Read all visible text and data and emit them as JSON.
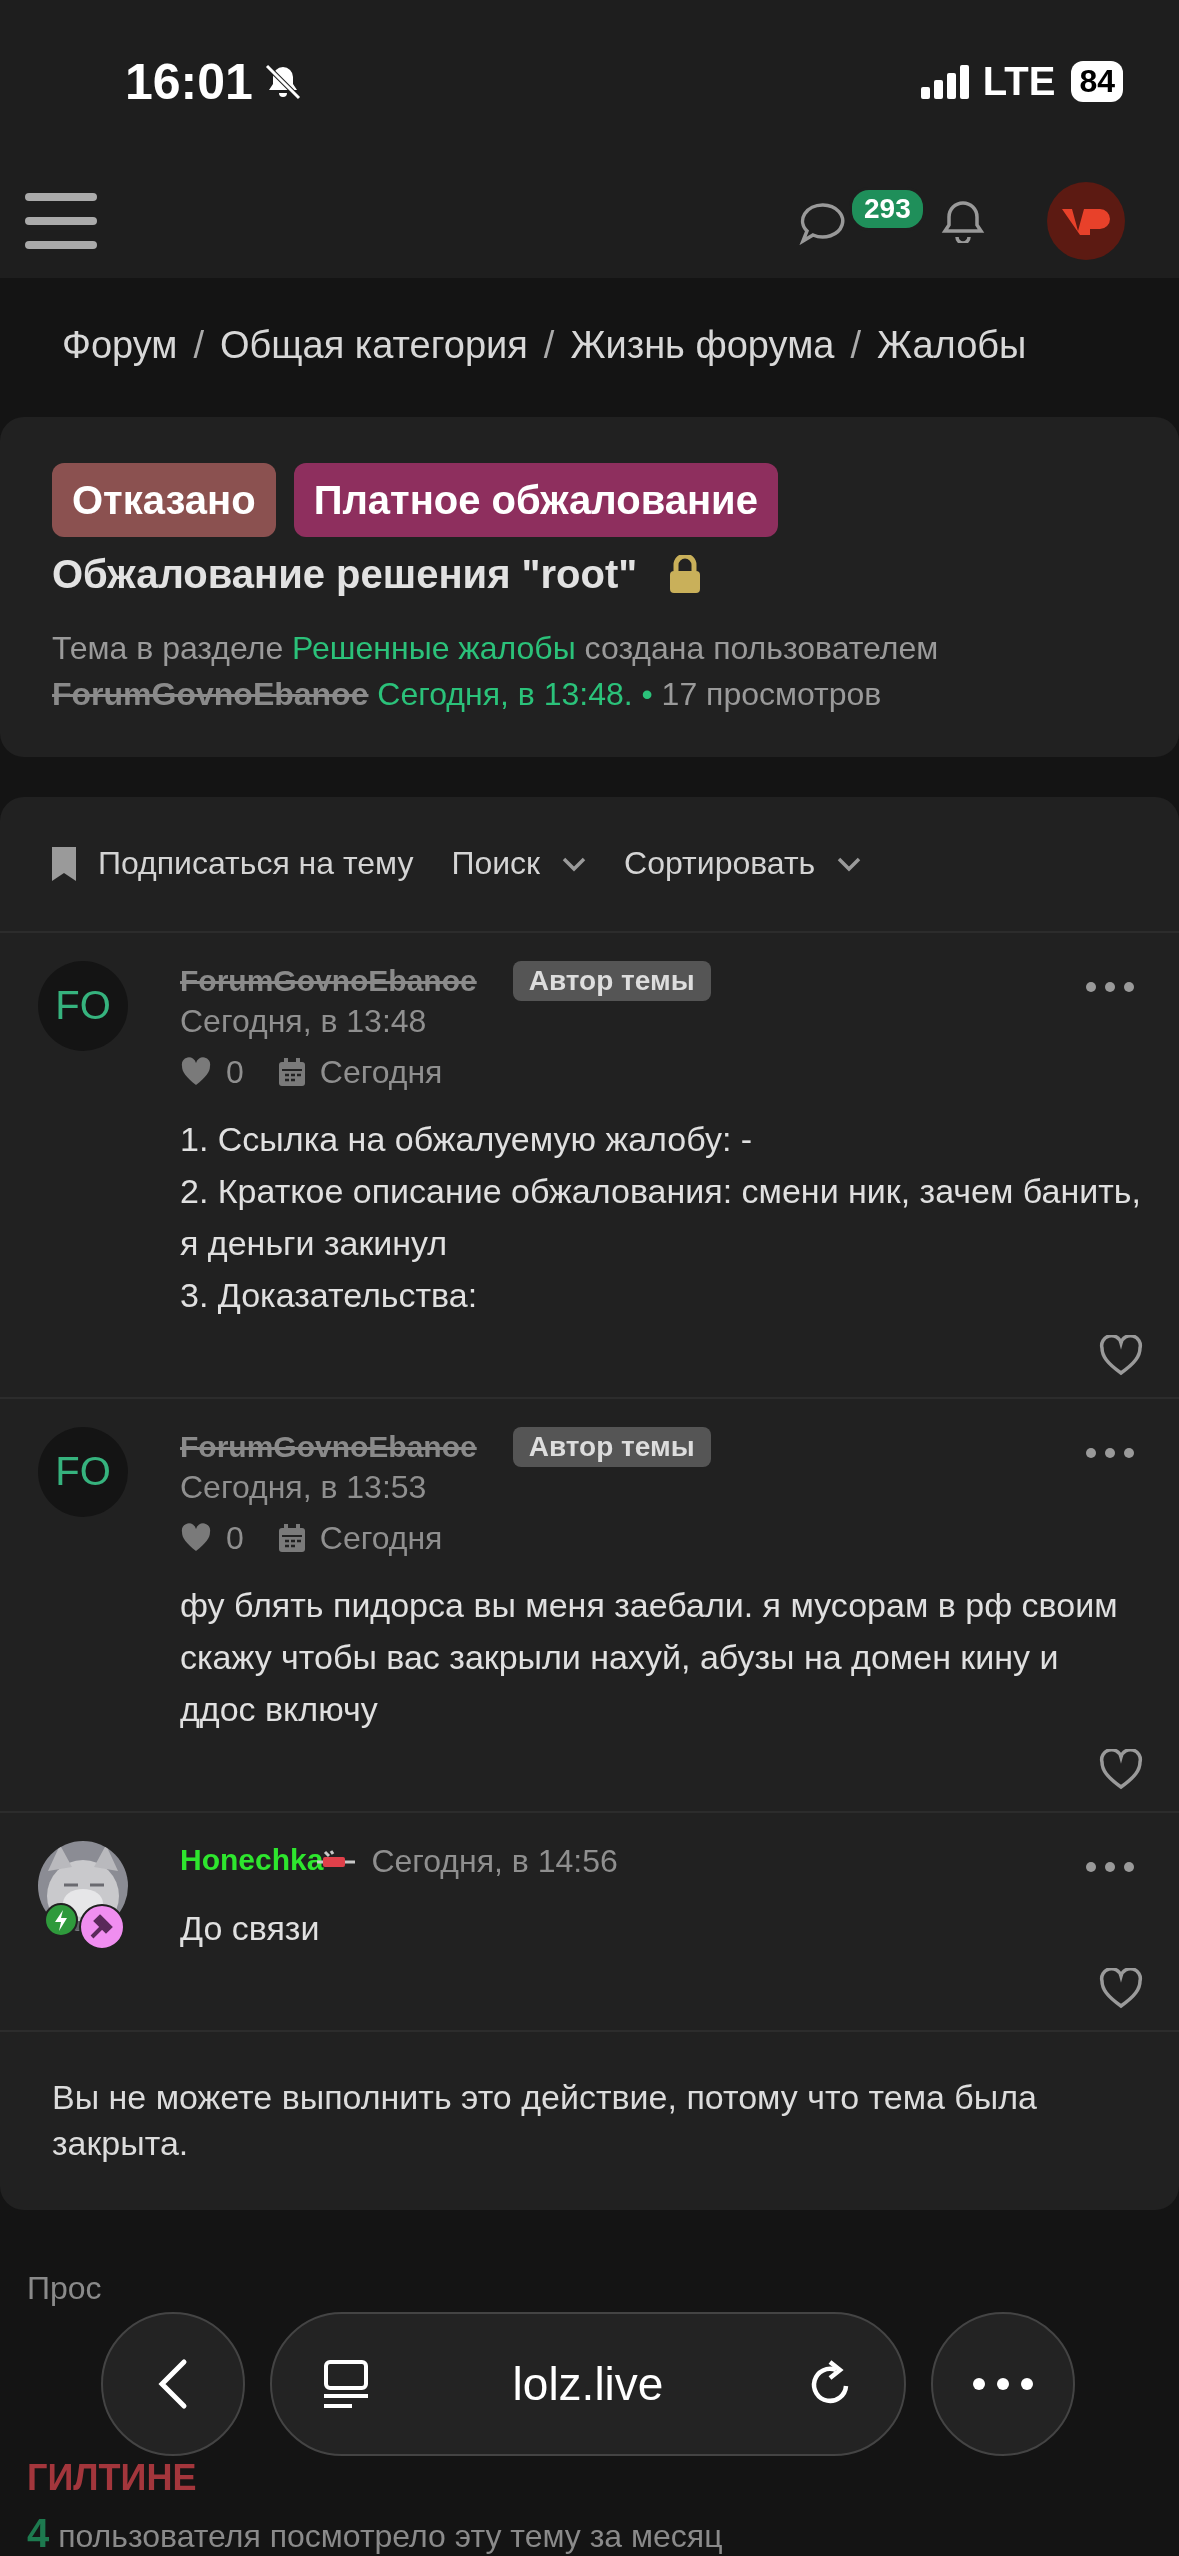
{
  "status_bar": {
    "time": "16:01",
    "network": "LTE",
    "battery": "84",
    "silent": true
  },
  "header": {
    "messages_count": "293"
  },
  "breadcrumbs": {
    "separator": "/",
    "items": [
      "Форум",
      "Общая категория",
      "Жизнь форума",
      "Жалобы"
    ]
  },
  "thread": {
    "prefixes": [
      {
        "label": "Отказано",
        "color": "#8b5150"
      },
      {
        "label": "Платное обжалование",
        "color": "#8e2f5e"
      }
    ],
    "title": "Обжалование решения \"root\"",
    "locked": true,
    "meta": {
      "intro": "Тема в разделе",
      "section": "Решенные жалобы",
      "created": "создана пользователем",
      "author": "ForumGovnoEbanoe",
      "date": "Сегодня, в 13:48.",
      "bullet": "•",
      "views": "17 просмотров"
    }
  },
  "toolbar": {
    "subscribe": "Подписаться на тему",
    "search": "Поиск",
    "sort": "Сортировать"
  },
  "posts": [
    {
      "kind": "full",
      "author": "ForumGovnoEbanoe",
      "struck": true,
      "avatar": "FO",
      "badge": "Автор темы",
      "date": "Сегодня, в 13:48",
      "likes": "0",
      "day": "Сегодня",
      "body": [
        "1. Ссылка на обжалуемую жалобу: -",
        "2. Краткое описание обжалования: смени ник, зачем банить, я деньги закинул",
        "3. Доказательства:"
      ]
    },
    {
      "kind": "full",
      "author": "ForumGovnoEbanoe",
      "struck": true,
      "avatar": "FO",
      "badge": "Автор темы",
      "date": "Сегодня, в 13:53",
      "likes": "0",
      "day": "Сегодня",
      "body": [
        "фу блять пидорса вы меня заебали. я мусорам в рф своим скажу чтобы вас закрыли нахуй, абузы на домен кину и ддос включу"
      ]
    },
    {
      "kind": "compact",
      "author": "Honechka",
      "struck": false,
      "color": "#2ee62e",
      "date": "Сегодня, в 14:56",
      "body": [
        "До связи"
      ]
    }
  ],
  "notice": "Вы не можете выполнить это действие, потому что тема была закрыта.",
  "viewers": {
    "label": "Прос",
    "users": [
      "ГИЛТИНЕ"
    ],
    "count": "4",
    "summary": "пользователя посмотрело эту тему за месяц"
  },
  "browser": {
    "url": "lolz.live"
  }
}
